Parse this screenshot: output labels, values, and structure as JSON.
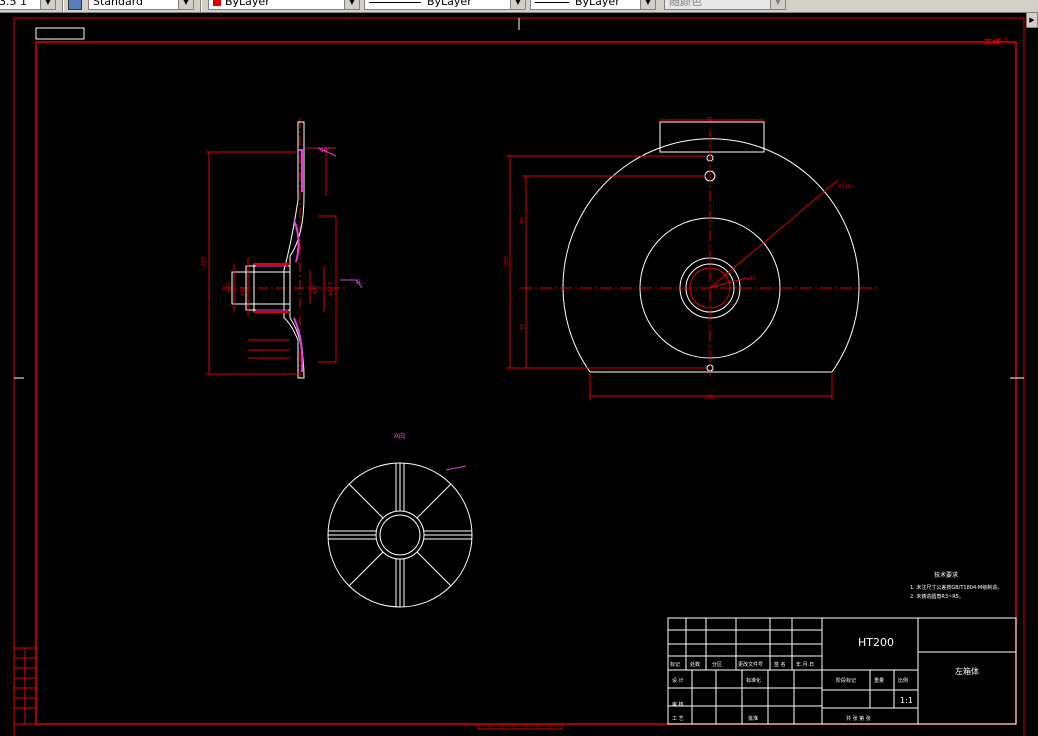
{
  "toolbar": {
    "scale_value": "3.5 1",
    "text_style": "Standard",
    "color": "ByLayer",
    "linetype": "ByLayer",
    "lineweight": "ByLayer",
    "plot_style": "随颜色"
  },
  "drawing": {
    "material": "HT200",
    "part_name": "左箱体",
    "scale": "1:1",
    "corner_roughness": "其余",
    "view_label": "A向",
    "section_arrow": "A",
    "tech_req_title": "技术要求",
    "tech_req_1": "1. 未注尺寸公差按GB/T1804-M级制造。",
    "tech_req_2": "2. 未铸造圆角R3~R5。",
    "dims": {
      "top_width": "75",
      "bottom_width": "231",
      "radius": "R120",
      "bore": "φ42",
      "height_total": "205",
      "height_upper": "90",
      "height_lower": "65",
      "side_total": "160",
      "side_d1": "φ42",
      "side_d2": "φ52",
      "side_d3": "φ97.5",
      "side_d4": "φ62",
      "angle": "60°"
    }
  },
  "title_block": {
    "h_biaoji": "标记",
    "h_chushu": "处数",
    "h_fenqu": "分区",
    "h_gengai": "更改文件号",
    "h_qianming": "签 名",
    "h_nianyueri": "年.月.日",
    "h_sheji": "设 计",
    "h_biaozhunhua": "标准化",
    "h_jieduan": "阶段标记",
    "h_zhongliang": "重量",
    "h_bili": "比例",
    "h_shenhe": "审 核",
    "h_gongyi": "工 艺",
    "h_pizhun": "批准",
    "h_gong_zhang": "共  张  第  张"
  }
}
